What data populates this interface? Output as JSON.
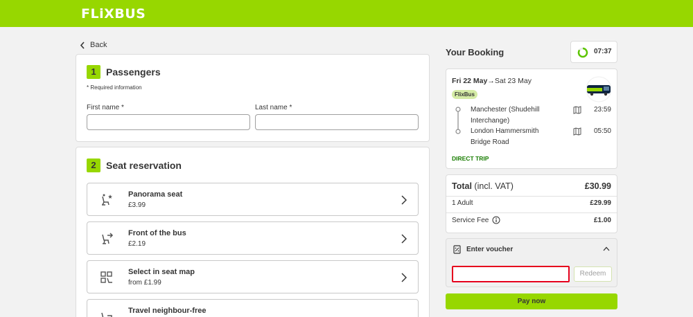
{
  "header": {
    "logo": "FLiXBUS"
  },
  "nav": {
    "back_label": "Back"
  },
  "passengers": {
    "step": "1",
    "title": "Passengers",
    "required_note": "* Required information",
    "first_name_label": "First name *",
    "last_name_label": "Last name *",
    "first_name_value": "",
    "last_name_value": ""
  },
  "seats": {
    "step": "2",
    "title": "Seat reservation",
    "items": [
      {
        "name": "Panorama seat",
        "price": "£3.99",
        "icon": "panorama-seat-icon"
      },
      {
        "name": "Front of the bus",
        "price": "£2.19",
        "icon": "front-seat-icon"
      },
      {
        "name": "Select in seat map",
        "price": "from £1.99",
        "icon": "seat-map-icon"
      },
      {
        "name": "Travel neighbour-free",
        "price": "",
        "icon": "neighbour-free-icon"
      }
    ]
  },
  "booking": {
    "title": "Your Booking",
    "timer": "07:37",
    "date_from": "Fri 22 May",
    "arrow": "→",
    "date_to": "Sat 23 May",
    "operator": "FlixBus",
    "from_stop": "Manchester (Shudehill Interchange)",
    "from_time": "23:59",
    "to_stop": "London Hammersmith Bridge Road",
    "to_time": "05:50",
    "trip_type": "DIRECT TRIP"
  },
  "price": {
    "total_label": "Total",
    "total_suffix": "(incl. VAT)",
    "total_value": "£30.99",
    "adult_label": "1 Adult",
    "adult_value": "£29.99",
    "fee_label": "Service Fee",
    "fee_value": "£1.00"
  },
  "voucher": {
    "label": "Enter voucher",
    "input_value": "",
    "redeem_label": "Redeem"
  },
  "pay": {
    "label": "Pay now"
  },
  "colors": {
    "brand": "#97d700",
    "error": "#e5001c",
    "direct": "#187d00"
  }
}
